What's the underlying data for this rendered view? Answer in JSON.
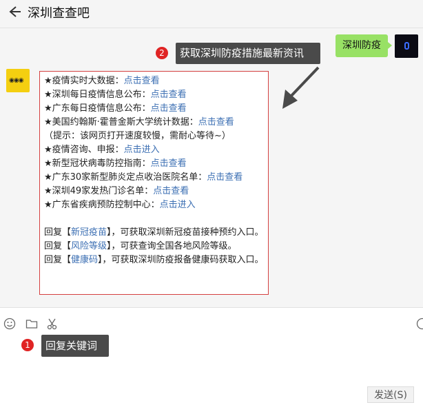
{
  "header": {
    "title": "深圳查查吧"
  },
  "chat": {
    "outgoing": {
      "text": "深圳防疫"
    },
    "incoming": {
      "lines": [
        {
          "label": "★疫情实时大数据：",
          "link": "点击查看"
        },
        {
          "label": "★深圳每日疫情信息公布：",
          "link": "点击查看"
        },
        {
          "label": "★广东每日疫情信息公布：",
          "link": "点击查看"
        },
        {
          "label": "★美国约翰斯·霍普金斯大学统计数据：",
          "link": "点击查看"
        },
        {
          "label": "（提示：该网页打开速度较慢，需耐心等待~）",
          "link": ""
        },
        {
          "label": "★疫情咨询、申报：",
          "link": "点击进入"
        },
        {
          "label": "★新型冠状病毒防控指南：",
          "link": "点击查看"
        },
        {
          "label": "★广东30家新型肺炎定点收治医院名单：",
          "link": "点击查看"
        },
        {
          "label": "★深圳49家发热门诊名单：",
          "link": "点击查看"
        },
        {
          "label": "★广东省疾病预防控制中心：",
          "link": "点击进入"
        }
      ],
      "replies": [
        {
          "prefix": "回复【",
          "keyword": "新冠疫苗",
          "suffix": "】，可获取深圳新冠疫苗接种预约入口。"
        },
        {
          "prefix": "回复【",
          "keyword": "风险等级",
          "suffix": "】，可获查询全国各地风险等级。"
        },
        {
          "prefix": "回复【",
          "keyword": "健康码",
          "suffix": "】，可获取深圳防疫报备健康码获取入口。"
        }
      ]
    }
  },
  "annotations": {
    "step2": {
      "number": "2",
      "text": "获取深圳防疫措施最新资讯"
    },
    "step1": {
      "number": "1",
      "text": "回复关键词"
    }
  },
  "input": {
    "send_label": "发送(S)"
  },
  "colors": {
    "bubble_out": "#98e165",
    "link": "#3c6fb3",
    "highlight_border": "#d43f3f",
    "badge": "#e02424"
  },
  "icons": [
    "back-arrow-icon",
    "emoji-icon",
    "folder-icon",
    "scissors-icon",
    "chat-icon"
  ]
}
